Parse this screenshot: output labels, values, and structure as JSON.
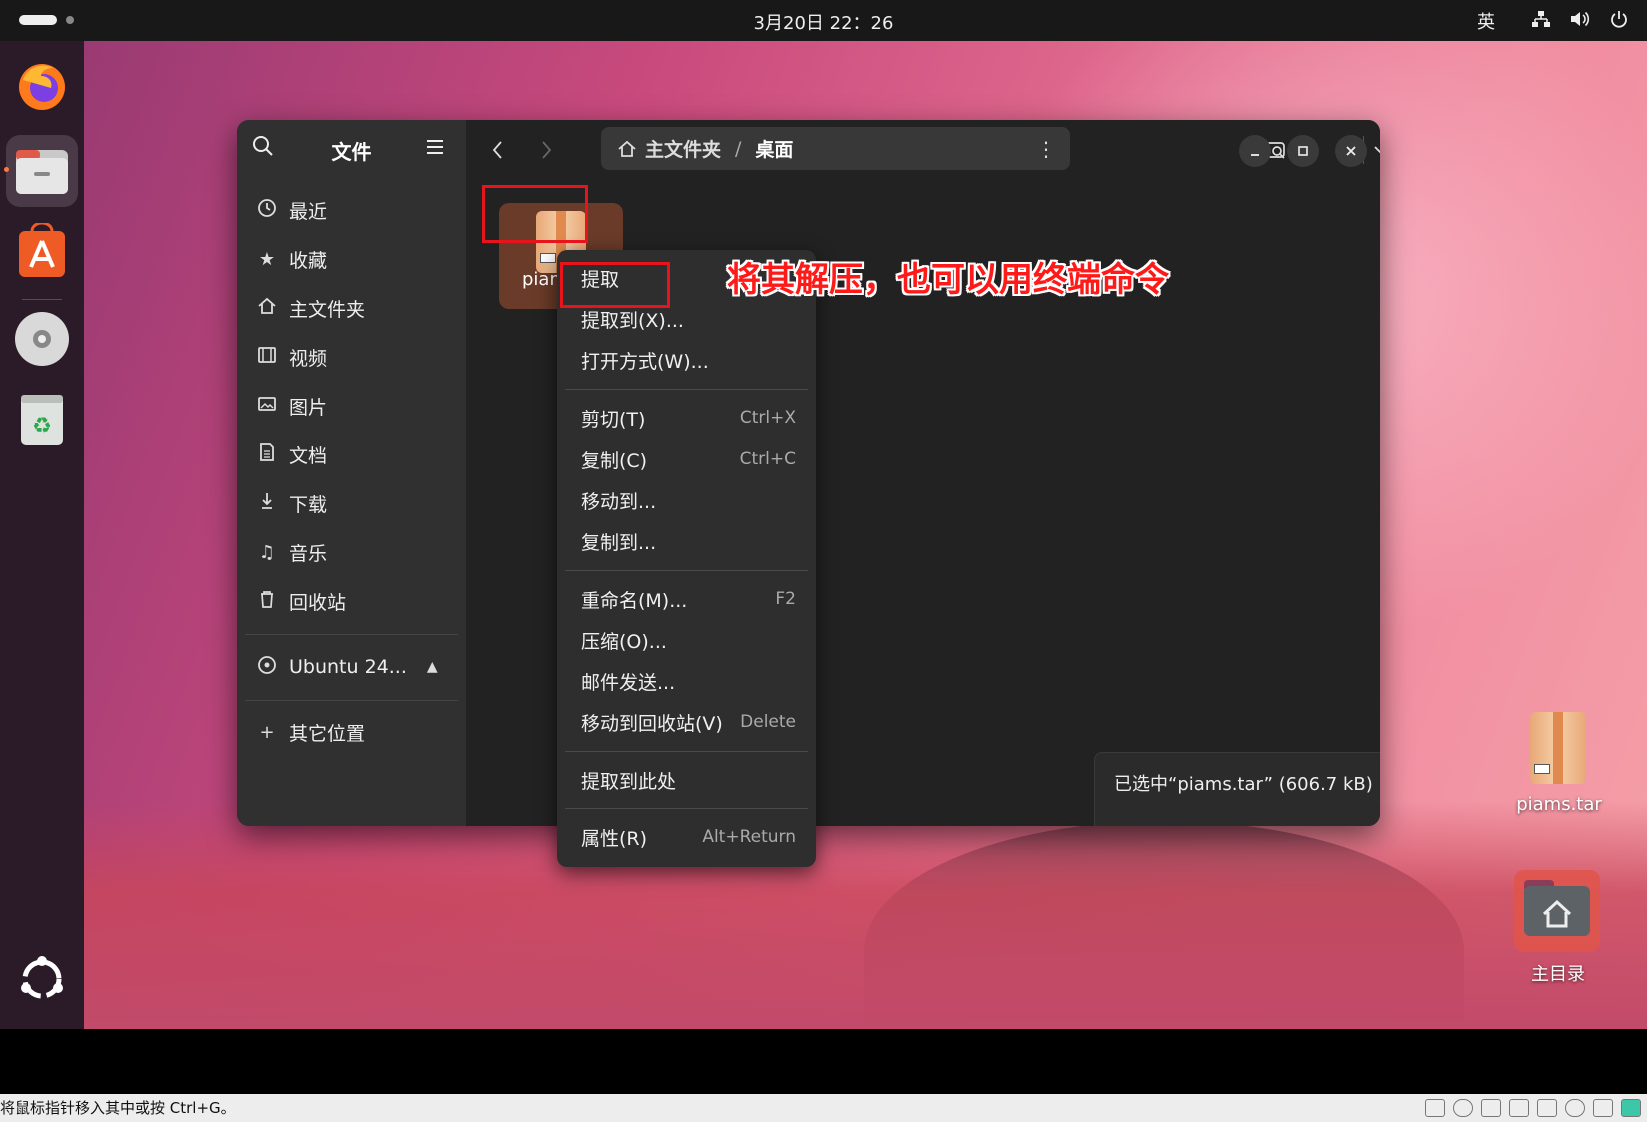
{
  "topbar": {
    "clock": "3月20日 22：26",
    "input_method": "英",
    "icons": [
      "activities-icon",
      "network-icon",
      "volume-icon",
      "power-icon"
    ]
  },
  "dock": {
    "apps": [
      "firefox-icon",
      "files-icon",
      "app-center-icon",
      "disc-icon",
      "trash-icon",
      "show-apps-icon"
    ]
  },
  "window": {
    "sidebar_title": "文件",
    "sidebar_items": [
      {
        "icon": "recent-icon",
        "label": "最近"
      },
      {
        "icon": "star-icon",
        "label": "收藏"
      },
      {
        "icon": "home-icon",
        "label": "主文件夹"
      },
      {
        "icon": "video-icon",
        "label": "视频"
      },
      {
        "icon": "picture-icon",
        "label": "图片"
      },
      {
        "icon": "document-icon",
        "label": "文档"
      },
      {
        "icon": "download-icon",
        "label": "下载"
      },
      {
        "icon": "music-icon",
        "label": "音乐"
      },
      {
        "icon": "trash-icon",
        "label": "回收站"
      }
    ],
    "device": {
      "label": "Ubuntu 24..."
    },
    "other_locations": "其它位置",
    "path": {
      "home": "主文件夹",
      "separator": "/",
      "current": "桌面"
    },
    "file": {
      "label": "piam"
    },
    "status": "已选中“piams.tar” (606.7 kB)"
  },
  "context_menu": {
    "groups": [
      [
        {
          "label": "提取",
          "shortcut": ""
        },
        {
          "label": "提取到(X)...",
          "shortcut": ""
        },
        {
          "label": "打开方式(W)...",
          "shortcut": ""
        }
      ],
      [
        {
          "label": "剪切(T)",
          "shortcut": "Ctrl+X"
        },
        {
          "label": "复制(C)",
          "shortcut": "Ctrl+C"
        },
        {
          "label": "移动到...",
          "shortcut": ""
        },
        {
          "label": "复制到...",
          "shortcut": ""
        }
      ],
      [
        {
          "label": "重命名(M)...",
          "shortcut": "F2"
        },
        {
          "label": "压缩(O)...",
          "shortcut": ""
        },
        {
          "label": "邮件发送...",
          "shortcut": ""
        },
        {
          "label": "移动到回收站(V)",
          "shortcut": "Delete"
        }
      ],
      [
        {
          "label": "提取到此处",
          "shortcut": ""
        }
      ],
      [
        {
          "label": "属性(R)",
          "shortcut": "Alt+Return"
        }
      ]
    ]
  },
  "annotation": "将其解压，也可以用终端命令",
  "desktop": {
    "icons": [
      {
        "label": "piams.tar"
      },
      {
        "label": "主目录"
      }
    ]
  },
  "vm_statusbar": "将鼠标指针移入其中或按 Ctrl+G。"
}
